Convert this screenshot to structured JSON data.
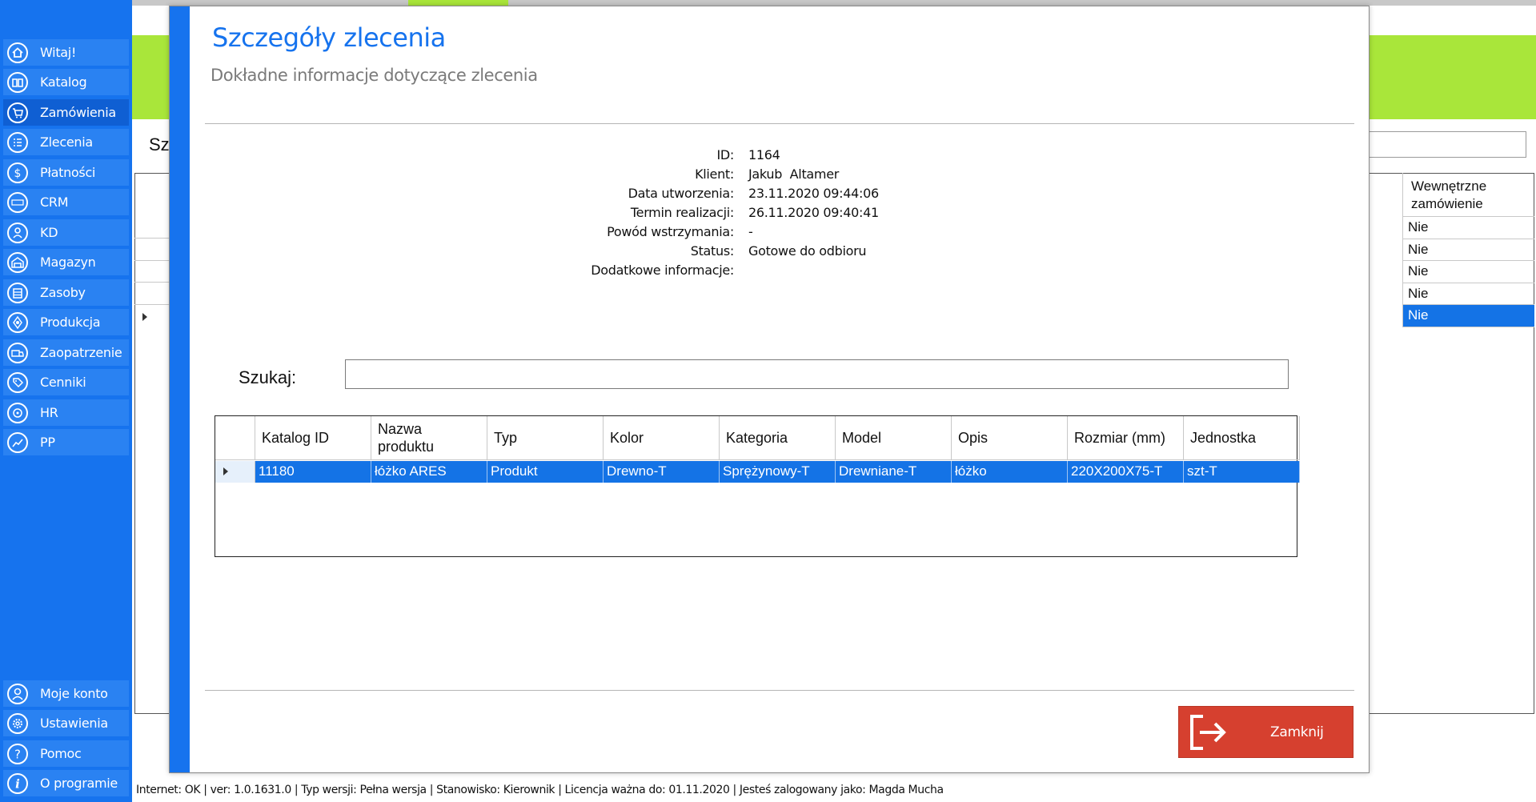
{
  "sidebar": {
    "items": [
      {
        "label": "Witaj!",
        "icon": "home-icon"
      },
      {
        "label": "Katalog",
        "icon": "book-icon"
      },
      {
        "label": "Zamówienia",
        "icon": "cart-icon"
      },
      {
        "label": "Zlecenia",
        "icon": "list-icon"
      },
      {
        "label": "Płatności",
        "icon": "dollar-icon"
      },
      {
        "label": "CRM",
        "icon": "crm-icon"
      },
      {
        "label": "KD",
        "icon": "user-icon"
      },
      {
        "label": "Magazyn",
        "icon": "warehouse-icon"
      },
      {
        "label": "Zasoby",
        "icon": "resources-icon"
      },
      {
        "label": "Produkcja",
        "icon": "production-icon"
      },
      {
        "label": "Zaopatrzenie",
        "icon": "truck-icon"
      },
      {
        "label": "Cenniki",
        "icon": "tag-icon"
      },
      {
        "label": "HR",
        "icon": "hr-icon"
      },
      {
        "label": "PP",
        "icon": "chart-icon"
      }
    ],
    "bottom_items": [
      {
        "label": "Moje konto",
        "icon": "account-icon"
      },
      {
        "label": "Ustawienia",
        "icon": "settings-icon"
      },
      {
        "label": "Pomoc",
        "icon": "help-icon"
      },
      {
        "label": "O programie",
        "icon": "info-icon"
      }
    ],
    "active_index": 2
  },
  "background": {
    "title_fragment": "Sz",
    "column_header": "Wewnętrzne zamówienie",
    "column_values": [
      "Nie",
      "Nie",
      "Nie",
      "Nie",
      "Nie"
    ],
    "selected_row_index": 4
  },
  "statusbar": {
    "text": "Internet: OK  |   ver: 1.0.1631.0   |   Typ wersji: Pełna wersja   |   Stanowisko: Kierownik   |   Licencja ważna do: 01.11.2020   |   Jesteś zalogowany jako: Magda Mucha"
  },
  "modal": {
    "title": "Szczegóły zlecenia",
    "subtitle": "Dokładne informacje dotyczące zlecenia",
    "details": [
      {
        "label": "ID:",
        "value": "1164"
      },
      {
        "label": "Klient:",
        "value": "Jakub  Altamer"
      },
      {
        "label": "Data utworzenia:",
        "value": "23.11.2020 09:44:06"
      },
      {
        "label": "Termin realizacji:",
        "value": "26.11.2020 09:40:41"
      },
      {
        "label": "Powód wstrzymania:",
        "value": "-"
      },
      {
        "label": "Status:",
        "value": "Gotowe do odbioru"
      },
      {
        "label": "Dodatkowe informacje:",
        "value": ""
      }
    ],
    "search": {
      "label": "Szukaj:",
      "value": "",
      "placeholder": ""
    },
    "grid": {
      "columns": [
        "Katalog ID",
        "Nazwa produktu",
        "Typ",
        "Kolor",
        "Kategoria",
        "Model",
        "Opis",
        "Rozmiar (mm)",
        "Jednostka"
      ],
      "rows": [
        [
          "11180",
          "łóżko ARES",
          "Produkt",
          "Drewno-T",
          "Sprężynowy-T",
          "Drewniane-T",
          "łóżko",
          "220X200X75-T",
          "szt-T"
        ]
      ]
    },
    "close_button": {
      "label": "Zamknij",
      "icon": "exit-icon"
    }
  },
  "colors": {
    "sidebar": "#1673ee",
    "accent_green": "#a9e63a",
    "selection": "#1473e6",
    "close_button": "#d6402f",
    "title_blue": "#1673ee"
  }
}
